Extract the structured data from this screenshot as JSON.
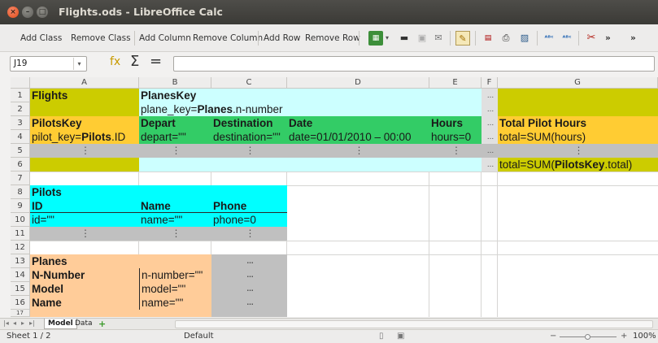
{
  "window": {
    "title": "Flights.ods - LibreOffice Calc"
  },
  "toolbar": {
    "add_class": "Add Class",
    "remove_class": "Remove Class",
    "add_column": "Add Column",
    "remove_column": "Remove Column",
    "add_row": "Add Row",
    "remove_row": "Remove Row",
    "more1": "»",
    "more2": "»"
  },
  "formula_bar": {
    "cell_ref": "J19",
    "content": ""
  },
  "columns": [
    "A",
    "B",
    "C",
    "D",
    "E",
    "F",
    "G"
  ],
  "rows": [
    "1",
    "2",
    "3",
    "4",
    "5",
    "6",
    "7",
    "8",
    "9",
    "10",
    "11",
    "12",
    "13",
    "14",
    "15",
    "16",
    "17"
  ],
  "cells": {
    "a1": "Flights",
    "b1": "PlanesKey",
    "f1": "...",
    "b2_pre": "plane_key=",
    "b2_bold": "Planes",
    "b2_post": ".n-number",
    "f2": "...",
    "a3": "PilotsKey",
    "b3": "Depart",
    "c3": "Destination",
    "d3": "Date",
    "e3": "Hours",
    "f3": "...",
    "g3": "Total Pilot Hours",
    "a4_pre": "pilot_key=",
    "a4_bold": "Pilots",
    "a4_post": ".ID",
    "b4": "depart=\"\"",
    "c4": "destination=\"\"",
    "d4": "date=01/01/2010 – 00:00",
    "e4": "hours=0",
    "f4": "...",
    "g4": "total=SUM(hours)",
    "vdots": "⋮",
    "f5": "...",
    "f6": "...",
    "g6_pre": "total=SUM(",
    "g6_bold": "PilotsKey",
    "g6_post": ".total)",
    "a8": "Pilots",
    "a9": "ID",
    "b9": "Name",
    "c9": "Phone",
    "a10": "id=\"\"",
    "b10": "name=\"\"",
    "c10": "phone=0",
    "a13": "Planes",
    "a14": "N-Number",
    "b14": "n-number=\"\"",
    "c14": "...",
    "a15": "Model",
    "b15": "model=\"\"",
    "c15": "...",
    "a16": "Name",
    "b16": "name=\"\"",
    "c16": "...",
    "c13": "..."
  },
  "sheet_tabs": [
    {
      "label": "Model",
      "active": true
    },
    {
      "label": "Data",
      "active": false
    }
  ],
  "status": {
    "sheet": "Sheet 1 / 2",
    "style": "Default",
    "zoom": "100%"
  },
  "colors": {
    "olive": "#cccc00",
    "cyan": "#ccffff",
    "green": "#33cc66",
    "gold": "#ffcc33",
    "grey": "#c0c0c0",
    "bright_cyan": "#00ffff",
    "peach": "#ffcc99"
  }
}
